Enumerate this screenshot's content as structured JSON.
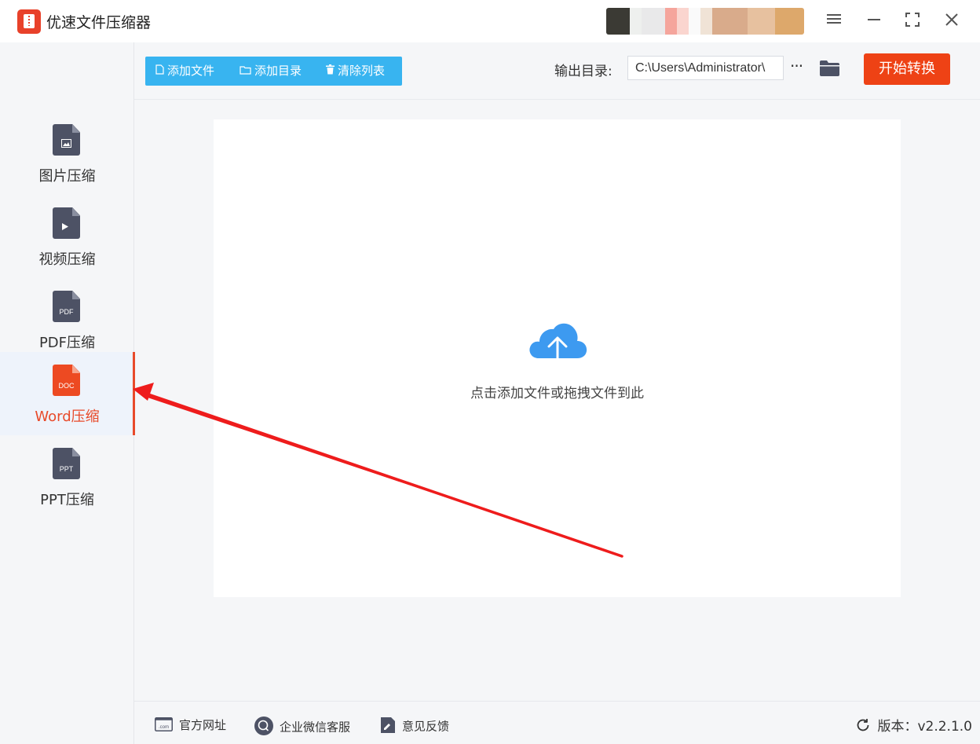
{
  "window": {
    "title": "优速文件压缩器"
  },
  "sidebar": {
    "items": [
      {
        "label": "图片压缩",
        "icon": "image-file-icon",
        "active": false
      },
      {
        "label": "视频压缩",
        "icon": "video-file-icon",
        "active": false
      },
      {
        "label": "PDF压缩",
        "icon_text": "PDF",
        "active": false
      },
      {
        "label": "Word压缩",
        "icon_text": "DOC",
        "active": true
      },
      {
        "label": "PPT压缩",
        "icon_text": "PPT",
        "active": false
      }
    ]
  },
  "toolbar": {
    "add_file": "添加文件",
    "add_folder": "添加目录",
    "clear_list": "清除列表",
    "output_label": "输出目录:",
    "output_path": "C:\\Users\\Administrator\\",
    "more": "···",
    "start": "开始转换"
  },
  "dropzone": {
    "text": "点击添加文件或拖拽文件到此"
  },
  "footer": {
    "website": "官方网址",
    "wechat": "企业微信客服",
    "feedback": "意见反馈",
    "version": "版本：v2.2.1.0"
  },
  "colors": {
    "accent": "#ee4215",
    "toolbar_blue": "#38b4f0",
    "cloud_blue": "#3d9af0",
    "annotation_arrow": "#ee1c1c"
  }
}
